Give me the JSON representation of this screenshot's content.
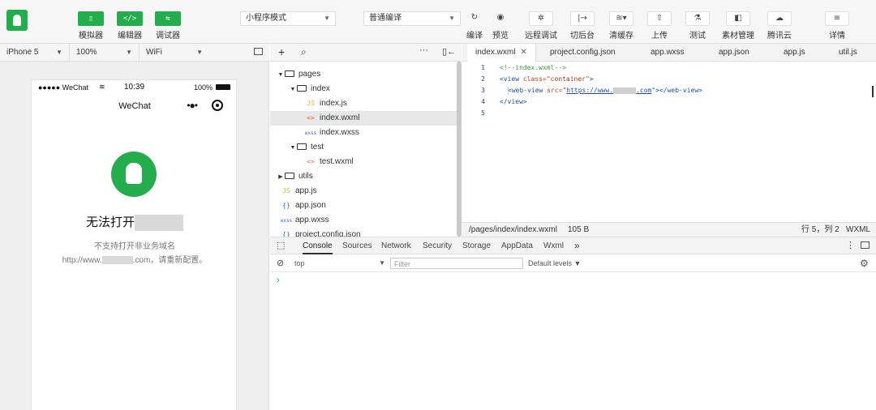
{
  "toolbar": {
    "left_buttons": [
      {
        "label": "模拟器",
        "icon": "phone-icon"
      },
      {
        "label": "编辑器",
        "icon": "code-icon"
      },
      {
        "label": "调试器",
        "icon": "debug-icon"
      }
    ],
    "mode_select": "小程序模式",
    "compile_select": "普通编译",
    "actions": [
      {
        "label": "编译",
        "icon": "refresh-icon"
      },
      {
        "label": "预览",
        "icon": "eye-icon"
      },
      {
        "label": "远程调试",
        "icon": "bug-icon"
      },
      {
        "label": "切后台",
        "icon": "switch-icon"
      },
      {
        "label": "清缓存",
        "icon": "layers-icon"
      },
      {
        "label": "上传",
        "icon": "upload-icon"
      },
      {
        "label": "测试",
        "icon": "flask-icon"
      },
      {
        "label": "素材管理",
        "icon": "folder-icon"
      },
      {
        "label": "腾讯云",
        "icon": "cloud-icon"
      },
      {
        "label": "详情",
        "icon": "menu-icon"
      }
    ]
  },
  "device_bar": {
    "device": "iPhone 5",
    "zoom": "100%",
    "network": "WiFi"
  },
  "simulator": {
    "status_left": "●●●●● WeChat",
    "status_time": "10:39",
    "status_battery": "100%",
    "nav_title": "WeChat",
    "error_title": "无法打开",
    "error_desc": "不支持打开非业务域名",
    "error_url_prefix": "http://www.",
    "error_url_suffix": ".com，请重新配置。"
  },
  "file_tree": {
    "items": [
      {
        "label": "pages",
        "type": "folder",
        "depth": 0,
        "expanded": true
      },
      {
        "label": "index",
        "type": "folder",
        "depth": 1,
        "expanded": true
      },
      {
        "label": "index.js",
        "type": "js",
        "depth": 2
      },
      {
        "label": "index.wxml",
        "type": "wxml",
        "depth": 2,
        "selected": true
      },
      {
        "label": "index.wxss",
        "type": "wxss",
        "depth": 2
      },
      {
        "label": "test",
        "type": "folder",
        "depth": 1,
        "expanded": true
      },
      {
        "label": "test.wxml",
        "type": "wxml",
        "depth": 2
      },
      {
        "label": "utils",
        "type": "folder",
        "depth": 0,
        "expanded": false
      },
      {
        "label": "app.js",
        "type": "js",
        "depth": 0
      },
      {
        "label": "app.json",
        "type": "json",
        "depth": 0
      },
      {
        "label": "app.wxss",
        "type": "wxss",
        "depth": 0
      },
      {
        "label": "project.config.json",
        "type": "json",
        "depth": 0
      }
    ]
  },
  "editor": {
    "tabs": [
      "index.wxml",
      "project.config.json",
      "app.wxss",
      "app.json",
      "app.js",
      "util.js"
    ],
    "active_tab": "index.wxml",
    "line_numbers": [
      "1",
      "2",
      "3",
      "4",
      "5"
    ],
    "code_lines": {
      "l1": "<!--index.wxml-->",
      "l2_tag": "<view",
      "l2_attr": " class=",
      "l2_val": "\"container\"",
      "l2_end": ">",
      "l3_tag": "<web-view",
      "l3_attr": " src=",
      "l3_quote": "\"",
      "l3_link_a": "https://www.",
      "l3_link_b": ".com",
      "l3_end": "\"></web-view>",
      "l4": "</view>"
    },
    "status_path": "/pages/index/index.wxml",
    "status_size": "105 B",
    "status_cursor": "行 5，列 2",
    "status_lang": "WXML"
  },
  "devtools": {
    "tabs": [
      "Console",
      "Sources",
      "Network",
      "Security",
      "Storage",
      "AppData",
      "Wxml"
    ],
    "active_tab": "Console",
    "more": "»",
    "context": "top",
    "filter_placeholder": "Filter",
    "levels": "Default levels ▼",
    "prompt": "›"
  }
}
